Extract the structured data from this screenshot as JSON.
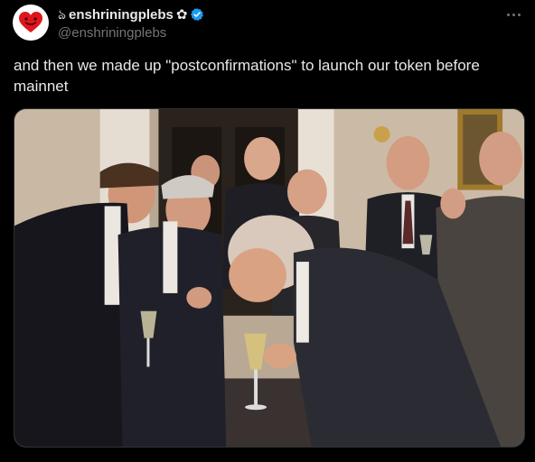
{
  "tweet": {
    "author": {
      "display_name": "enshriningplebs",
      "prefix_glyph": "ঌ",
      "suffix_glyph": "✿",
      "handle": "@enshriningplebs",
      "verified": true,
      "avatar_icon": "heart-icon"
    },
    "more_icon": "more-horizontal-icon",
    "text": "and then we made up \"postconfirmations\" to launch our token before mainnet",
    "media": {
      "type": "photo",
      "icon": "meme-photo"
    }
  },
  "colors": {
    "background": "#000000",
    "text": "#e7e9ea",
    "secondary_text": "#71767b",
    "verified_blue": "#1d9bf0",
    "avatar_heart": "#e0161e"
  }
}
